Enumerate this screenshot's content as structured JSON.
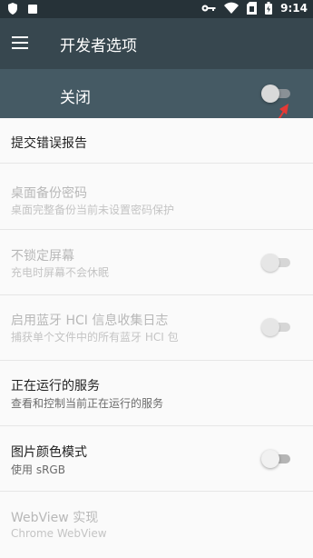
{
  "status_bar": {
    "time": "9:14",
    "icons": [
      "shield-icon",
      "square-icon",
      "key-icon",
      "wifi-icon",
      "sim-icon",
      "battery-icon"
    ]
  },
  "header": {
    "menu_icon": "menu-icon",
    "title": "开发者选项"
  },
  "master": {
    "label": "关闭",
    "switch_on": false
  },
  "items": [
    {
      "title": "提交错误报告",
      "enabled": true
    },
    {
      "title": "桌面备份密码",
      "subtitle": "桌面完整备份当前未设置密码保护",
      "enabled": false
    },
    {
      "title": "不锁定屏幕",
      "subtitle": "充电时屏幕不会休眠",
      "enabled": false,
      "switch_on": false
    },
    {
      "title": "启用蓝牙 HCI 信息收集日志",
      "subtitle": "捕获单个文件中的所有蓝牙 HCI 包",
      "enabled": false,
      "switch_on": false
    },
    {
      "title": "正在运行的服务",
      "subtitle": "查看和控制当前正在运行的服务",
      "enabled": true
    },
    {
      "title": "图片颜色模式",
      "subtitle": "使用 sRGB",
      "enabled": true,
      "switch_on": false
    },
    {
      "title": "WebView 实现",
      "subtitle": "Chrome WebView",
      "enabled": false
    }
  ],
  "colors": {
    "status_bar": "#263238",
    "app_bar": "#37474f",
    "master_bar": "#455a64",
    "annotation_arrow": "#e53935"
  }
}
